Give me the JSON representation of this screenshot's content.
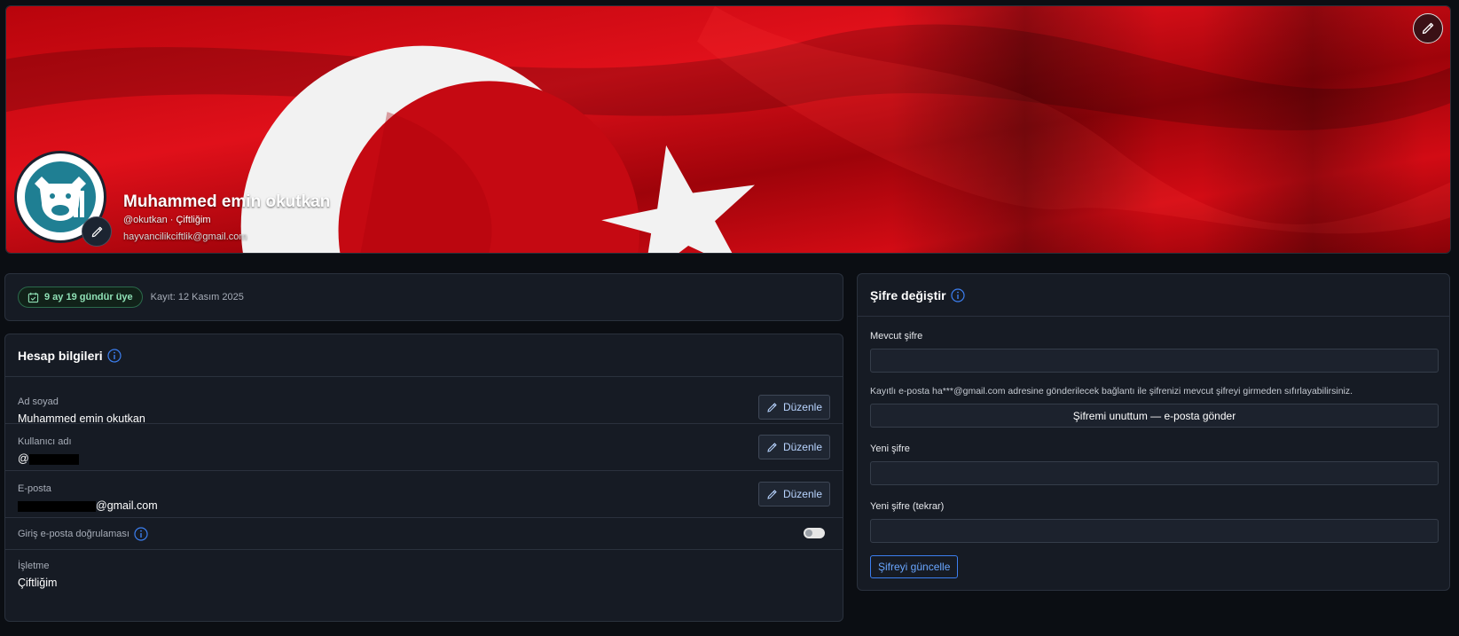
{
  "profile": {
    "name": "Muhammed emin okutkan",
    "username": "@okutkan",
    "separator": " · ",
    "business": "Çiftliğim",
    "email": "hayvancilikciftlik@gmail.com"
  },
  "membership": {
    "badge": "9 ay 19 gündür üye",
    "registered": "Kayıt: 12 Kasım 2025"
  },
  "account": {
    "title": "Hesap bilgileri",
    "edit_label": "Düzenle",
    "fullname_label": "Ad soyad",
    "fullname_value": "Muhammed emin okutkan",
    "username_label": "Kullanıcı adı",
    "username_prefix": "@",
    "email_label": "E-posta",
    "email_suffix": "@gmail.com",
    "login_verify_label": "Giriş e-posta doğrulaması",
    "business_label": "İşletme",
    "business_value": "Çiftliğim"
  },
  "password": {
    "title": "Şifre değiştir",
    "current_label": "Mevcut şifre",
    "hint": "Kayıtlı e-posta ha***@gmail.com adresine gönderilecek bağlantı ile şifrenizi mevcut şifreyi girmeden sıfırlayabilirsiniz.",
    "forgot_button": "Şifremi unuttum — e-posta gönder",
    "new_label": "Yeni şifre",
    "new_repeat_label": "Yeni şifre (tekrar)",
    "update_button": "Şifreyi güncelle"
  },
  "colors": {
    "flag_red": "#d90a12",
    "accent_blue": "#3c7ff0",
    "badge_green": "#8fe0b5"
  },
  "icons": {
    "banner_edit": "pencil-icon",
    "avatar_edit": "pencil-icon",
    "member": "calendar-check-icon",
    "info": "info-icon",
    "edit": "pencil-icon"
  }
}
